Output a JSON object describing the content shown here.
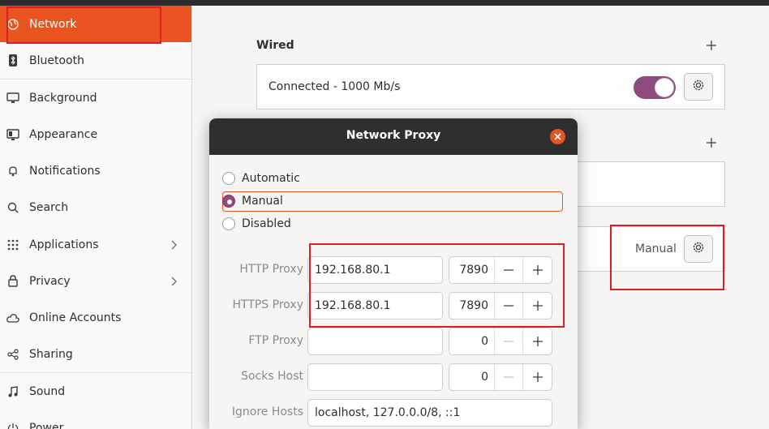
{
  "sidebar": {
    "items": [
      {
        "label": "Network",
        "icon": "globe-icon",
        "active": true
      },
      {
        "label": "Bluetooth",
        "icon": "bluetooth-icon"
      },
      {
        "label": "Background",
        "icon": "monitor-icon"
      },
      {
        "label": "Appearance",
        "icon": "appearance-icon"
      },
      {
        "label": "Notifications",
        "icon": "bell-icon"
      },
      {
        "label": "Search",
        "icon": "search-icon"
      },
      {
        "label": "Applications",
        "icon": "grid-icon",
        "has_chevron": true
      },
      {
        "label": "Privacy",
        "icon": "lock-icon",
        "has_chevron": true
      },
      {
        "label": "Online Accounts",
        "icon": "cloud-icon"
      },
      {
        "label": "Sharing",
        "icon": "share-icon"
      },
      {
        "label": "Sound",
        "icon": "music-icon"
      },
      {
        "label": "Power",
        "icon": "power-icon"
      }
    ]
  },
  "main": {
    "wired": {
      "title": "Wired",
      "status": "Connected - 1000 Mb/s",
      "toggle_on": true
    },
    "proxy_row": {
      "value": "Manual"
    }
  },
  "dialog": {
    "title": "Network Proxy",
    "options": [
      "Automatic",
      "Manual",
      "Disabled"
    ],
    "selected": "Manual",
    "fields": [
      {
        "label": "HTTP Proxy",
        "host": "192.168.80.1",
        "port": "7890"
      },
      {
        "label": "HTTPS Proxy",
        "host": "192.168.80.1",
        "port": "7890"
      },
      {
        "label": "FTP Proxy",
        "host": "",
        "port": "0"
      },
      {
        "label": "Socks Host",
        "host": "",
        "port": "0"
      }
    ],
    "ignore_hosts": {
      "label": "Ignore Hosts",
      "value": "localhost, 127.0.0.0/8, ::1"
    }
  },
  "colors": {
    "accent": "#e95420",
    "toggle": "#8e4b7f",
    "highlight_box": "#e11b22"
  }
}
